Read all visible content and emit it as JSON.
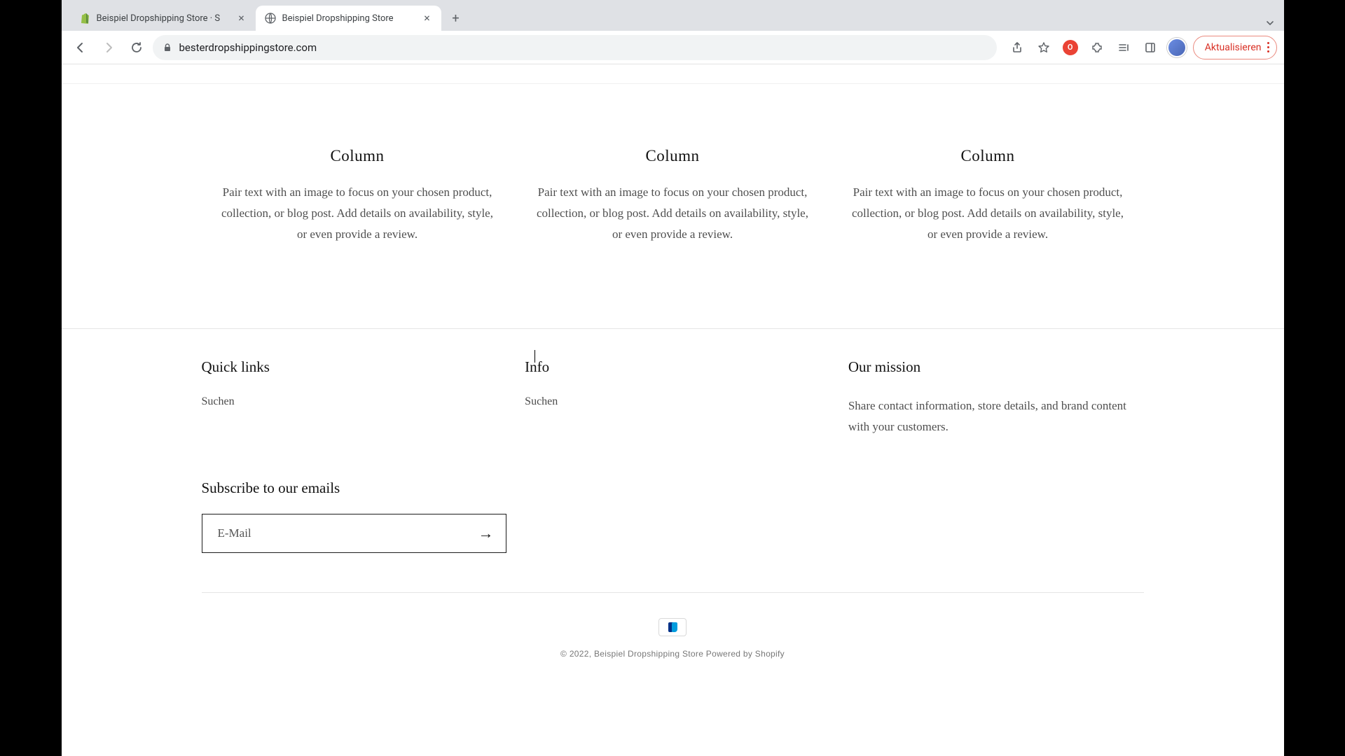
{
  "browser": {
    "tabs": [
      {
        "title": "Beispiel Dropshipping Store · S",
        "active": false,
        "favicon": "shopify"
      },
      {
        "title": "Beispiel Dropshipping Store",
        "active": true,
        "favicon": "globe"
      }
    ],
    "url": "besterdropshippingstore.com",
    "update_label": "Aktualisieren"
  },
  "columns": [
    {
      "heading": "Column",
      "body": "Pair text with an image to focus on your chosen product, collection, or blog post. Add details on availability, style, or even provide a review."
    },
    {
      "heading": "Column",
      "body": "Pair text with an image to focus on your chosen product, collection, or blog post. Add details on availability, style, or even provide a review."
    },
    {
      "heading": "Column",
      "body": "Pair text with an image to focus on your chosen product, collection, or blog post. Add details on availability, style, or even provide a review."
    }
  ],
  "footer": {
    "quick_links": {
      "heading": "Quick links",
      "items": [
        "Suchen"
      ]
    },
    "info": {
      "heading": "Info",
      "items": [
        "Suchen"
      ]
    },
    "mission": {
      "heading": "Our mission",
      "body": "Share contact information, store details, and brand content with your customers."
    },
    "subscribe": {
      "heading": "Subscribe to our emails",
      "email_placeholder": "E-Mail"
    },
    "copyright": "© 2022, Beispiel Dropshipping Store Powered by Shopify"
  }
}
